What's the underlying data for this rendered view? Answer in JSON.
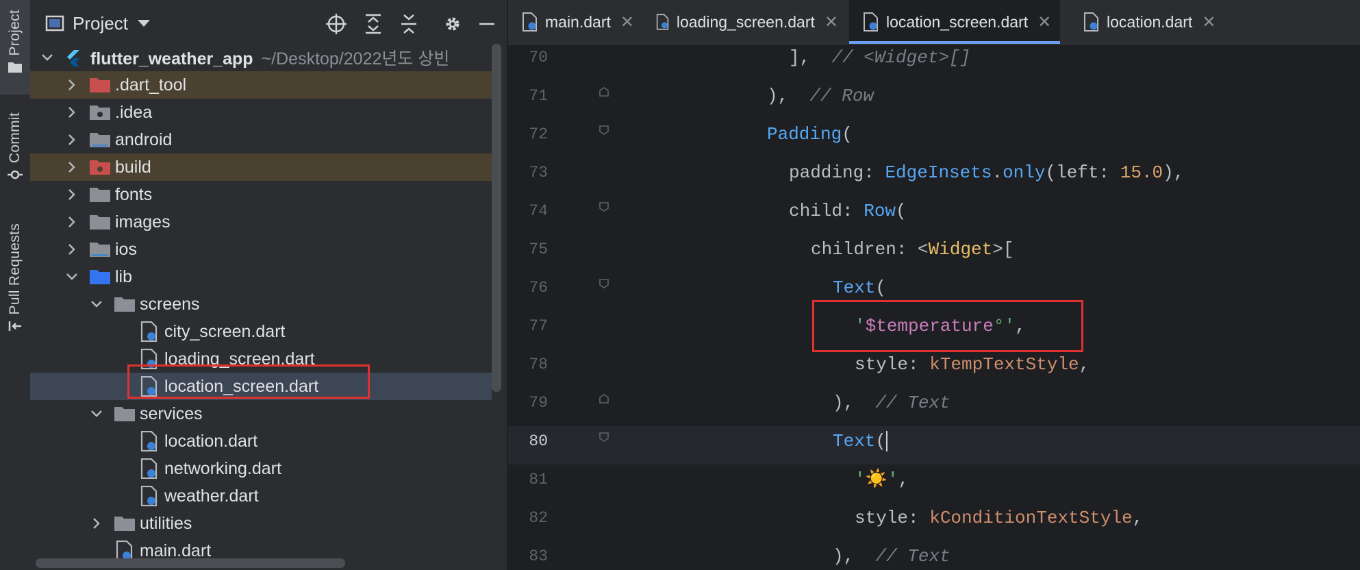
{
  "tool_strip": {
    "tabs": [
      {
        "label": "Project",
        "active": true
      },
      {
        "label": "Commit",
        "active": false
      },
      {
        "label": "Pull Requests",
        "active": false
      }
    ]
  },
  "project_panel": {
    "title": "Project",
    "root": {
      "name": "flutter_weather_app",
      "path": "~/Desktop/2022년도 상빈"
    },
    "items": [
      {
        "label": ".dart_tool",
        "type": "folder",
        "expanded": false,
        "excluded": true
      },
      {
        "label": ".idea",
        "type": "folder",
        "expanded": false
      },
      {
        "label": "android",
        "type": "folder",
        "expanded": false
      },
      {
        "label": "build",
        "type": "folder",
        "expanded": false,
        "excluded": true
      },
      {
        "label": "fonts",
        "type": "folder",
        "expanded": false
      },
      {
        "label": "images",
        "type": "folder",
        "expanded": false
      },
      {
        "label": "ios",
        "type": "folder",
        "expanded": false
      },
      {
        "label": "lib",
        "type": "folder",
        "expanded": true
      },
      {
        "label": "screens",
        "type": "folder",
        "expanded": true
      },
      {
        "label": "city_screen.dart",
        "type": "file"
      },
      {
        "label": "loading_screen.dart",
        "type": "file"
      },
      {
        "label": "location_screen.dart",
        "type": "file",
        "selected": true
      },
      {
        "label": "services",
        "type": "folder",
        "expanded": true
      },
      {
        "label": "location.dart",
        "type": "file"
      },
      {
        "label": "networking.dart",
        "type": "file"
      },
      {
        "label": "weather.dart",
        "type": "file"
      },
      {
        "label": "utilities",
        "type": "folder",
        "expanded": false
      },
      {
        "label": "main.dart",
        "type": "file"
      }
    ]
  },
  "editor": {
    "tabs": [
      {
        "label": "main.dart",
        "active": false
      },
      {
        "label": "loading_screen.dart",
        "active": false
      },
      {
        "label": "location_screen.dart",
        "active": true
      },
      {
        "label": "location.dart",
        "active": false
      }
    ],
    "current_line": 80,
    "lines": [
      {
        "n": "70",
        "text": "],  // <Widget>[]"
      },
      {
        "n": "71",
        "text": "),  // Row"
      },
      {
        "n": "72",
        "text": "Padding("
      },
      {
        "n": "73",
        "text": "padding: EdgeInsets.only(left: 15.0),"
      },
      {
        "n": "74",
        "text": "child: Row("
      },
      {
        "n": "75",
        "text": "children: <Widget>["
      },
      {
        "n": "76",
        "text": "Text("
      },
      {
        "n": "77",
        "text": "'$temperature°',"
      },
      {
        "n": "78",
        "text": "style: kTempTextStyle,"
      },
      {
        "n": "79",
        "text": "),  // Text"
      },
      {
        "n": "80",
        "text": "Text("
      },
      {
        "n": "81",
        "text": "'☀️',"
      },
      {
        "n": "82",
        "text": "style: kConditionTextStyle,"
      },
      {
        "n": "83",
        "text": "),  // Text"
      }
    ]
  },
  "colors": {
    "accent": "#6b9ef0",
    "highlight_box": "#e03131",
    "excluded_folder": "#4a4130",
    "selected_row": "#3d4654"
  }
}
